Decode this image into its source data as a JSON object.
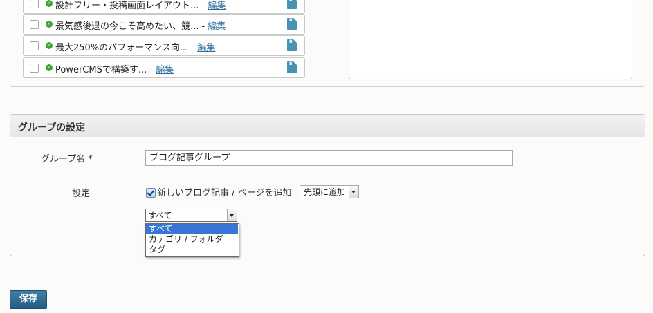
{
  "entries": [
    {
      "title": "設計フリー・投稿画面レイアウト... - ",
      "edit": "編集"
    },
    {
      "title": "景気感後退の今こそ高めたい、競... - ",
      "edit": "編集"
    },
    {
      "title": "最大250%のパフォーマンス向... - ",
      "edit": "編集"
    },
    {
      "title": "PowerCMSで構築す... - ",
      "edit": "編集"
    }
  ],
  "blog_icon_glyph": "B",
  "group_settings": {
    "heading": "グループの設定",
    "name_label": "グループ名 *",
    "name_value": "ブログ記事グループ",
    "settings_label": "設定",
    "add_new_label": "新しいブログ記事 / ページを追加",
    "add_new_checked": true,
    "position_select": "先頭に追加",
    "filter_select": "すべて",
    "filter_options": [
      "すべて",
      "カテゴリ / フォルダ",
      "タグ"
    ],
    "filter_selected_index": 0
  },
  "save_label": "保存",
  "colors": {
    "link": "#2a6c9a",
    "status_ok": "#3ea33e",
    "save_button": "#2d6a92",
    "selection": "#3875d7"
  },
  "icons": {
    "status": "check-circle-icon",
    "blog": "blog-entry-icon"
  }
}
